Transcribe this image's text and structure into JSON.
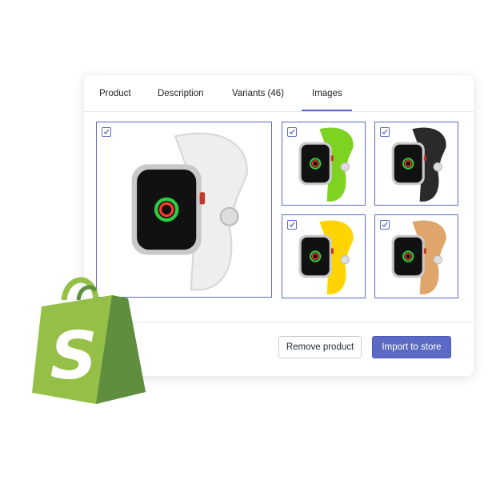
{
  "tabs": [
    {
      "label": "Product"
    },
    {
      "label": "Description"
    },
    {
      "label": "Variants (46)"
    },
    {
      "label": "Images",
      "active": true
    }
  ],
  "images": [
    {
      "band_color": "#eeeeee",
      "checked": true
    },
    {
      "band_color": "#7ed321",
      "checked": true
    },
    {
      "band_color": "#2a2a2a",
      "checked": true
    },
    {
      "band_color": "#ffd400",
      "checked": true
    },
    {
      "band_color": "#e0a56a",
      "checked": true
    }
  ],
  "buttons": {
    "remove": "Remove product",
    "import": "Import to store"
  },
  "colors": {
    "accent": "#5c6ac4",
    "shopify_green": "#95bf47"
  },
  "logo": {
    "name": "shopify-bag-icon",
    "text": "S"
  }
}
